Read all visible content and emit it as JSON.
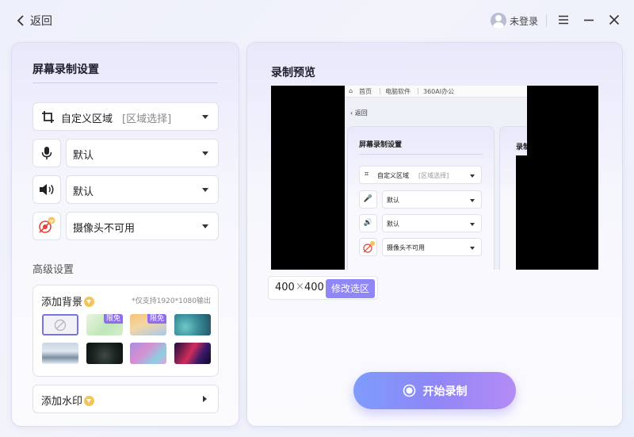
{
  "titlebar": {
    "back_label": "返回",
    "login_label": "未登录"
  },
  "left_panel": {
    "title": "屏幕录制设置",
    "region": {
      "label": "自定义区域",
      "hint": "[区域选择]"
    },
    "mic": {
      "value": "默认"
    },
    "speaker": {
      "value": "默认"
    },
    "camera": {
      "value": "摄像头不可用"
    },
    "advanced_title": "高级设置",
    "background": {
      "label": "添加背景",
      "note": "*仅支持1920*1080输出",
      "free_tag": "限免"
    },
    "watermark": {
      "label": "添加水印"
    }
  },
  "right_panel": {
    "title": "录制预览",
    "size_width": "400",
    "size_times": "×",
    "size_height": "400",
    "modify_label": "修改选区",
    "start_label": "开始录制"
  },
  "preview_inner": {
    "nav_home": "首页",
    "nav_software": "电脑软件",
    "nav_office": "360AI办公",
    "back_label": "返回",
    "settings_title": "屏幕录制设置",
    "region_label": "自定义区域",
    "region_hint": "[区域选择]",
    "mic_value": "默认",
    "speaker_value": "默认",
    "camera_value": "摄像头不可用",
    "right_title_cut": "录制"
  },
  "colors": {
    "accent": "#8f86f7",
    "tag_purple": "#8f6cf0",
    "crown_gold": "#f3c45a",
    "camera_red": "#e0443c"
  }
}
